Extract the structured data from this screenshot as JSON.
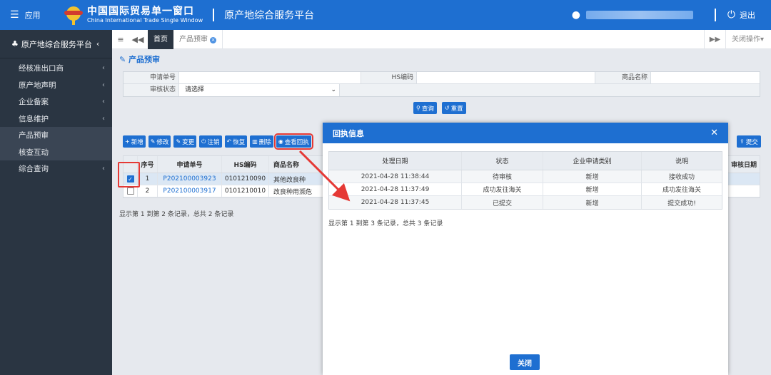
{
  "topbar": {
    "app_label": "应用",
    "logo_title": "中国国际贸易单一窗口",
    "logo_subtitle": "China International Trade Single Window",
    "platform_title": "原产地综合服务平台",
    "logout_label": "退出"
  },
  "sidebar": {
    "header": "原产地综合服务平台",
    "items": [
      {
        "label": "经核准出口商",
        "has_children": true
      },
      {
        "label": "原产地声明",
        "has_children": true
      },
      {
        "label": "企业备案",
        "has_children": true
      },
      {
        "label": "信息维护",
        "has_children": true
      },
      {
        "label": "产品预审",
        "has_children": false
      },
      {
        "label": "核查互动",
        "has_children": false
      },
      {
        "label": "综合查询",
        "has_children": true
      }
    ]
  },
  "tabs": {
    "home": "首页",
    "active_tab": "产品预审",
    "close_ops": "关闭操作"
  },
  "main": {
    "title": "产品预审",
    "form": {
      "application_no_label": "申请单号",
      "hs_code_label": "HS编码",
      "product_name_label": "商品名称",
      "review_status_label": "审核状态",
      "review_status_value": "请选择"
    },
    "search_button": "查询",
    "reset_button": "重置",
    "toolbar": {
      "add": "新增",
      "edit": "修改",
      "change": "变更",
      "cancel": "注销",
      "restore": "恢复",
      "delete": "删除",
      "view_receipt": "查看回执",
      "submit": "提交"
    },
    "table": {
      "headers": {
        "no": "序号",
        "app_no": "申请单号",
        "hs": "HS编码",
        "name": "商品名称",
        "review_date": "审核日期"
      },
      "rows": [
        {
          "no": "1",
          "app_no": "P202100003923",
          "hs": "0101210090",
          "name": "其他改良种",
          "checked": true
        },
        {
          "no": "2",
          "app_no": "P202100003917",
          "hs": "0101210010",
          "name": "改良种用濒危",
          "checked": false
        }
      ]
    },
    "footer": "显示第 1 到第 2 条记录，总共 2 条记录"
  },
  "modal": {
    "title": "回执信息",
    "headers": {
      "date": "处理日期",
      "status": "状态",
      "type": "企业申请类别",
      "desc": "说明"
    },
    "rows": [
      {
        "date": "2021-04-28 11:38:44",
        "status": "待审核",
        "type": "新增",
        "desc": "接收成功"
      },
      {
        "date": "2021-04-28 11:37:49",
        "status": "成功发往海关",
        "type": "新增",
        "desc": "成功发往海关"
      },
      {
        "date": "2021-04-28 11:37:45",
        "status": "已提交",
        "type": "新增",
        "desc": "提交成功!"
      }
    ],
    "footer": "显示第 1 到第 3 条记录，总共 3 条记录",
    "close_button": "关闭"
  },
  "colors": {
    "primary": "#1e6fd1",
    "sidebar": "#2a3542",
    "highlight": "#e53935"
  }
}
